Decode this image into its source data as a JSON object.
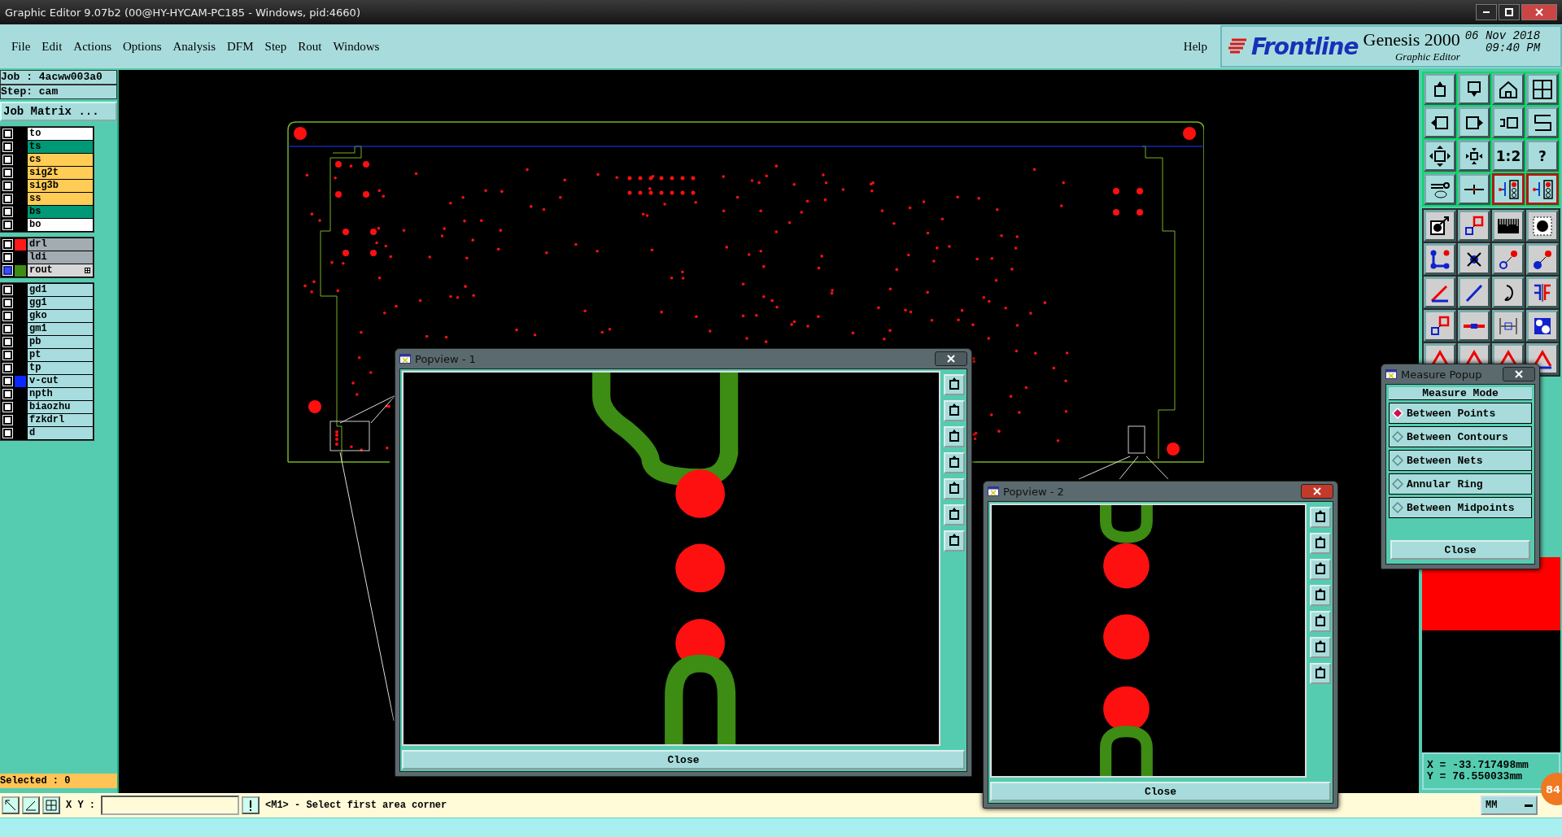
{
  "window": {
    "title": "Graphic Editor 9.07b2 (00@HY-HYCAM-PC185 - Windows, pid:4660)"
  },
  "menu": [
    "File",
    "Edit",
    "Actions",
    "Options",
    "Analysis",
    "DFM",
    "Step",
    "Rout",
    "Windows"
  ],
  "help": "Help",
  "brand": {
    "logo": "Frontline",
    "product": "Genesis 2000",
    "subtitle": "Graphic Editor",
    "date": "06 Nov 2018",
    "time": "09:40 PM"
  },
  "job": {
    "job": "Job : 4acww003a0",
    "step": "Step: cam",
    "matrix_button": "Job Matrix ..."
  },
  "layer_groups": [
    {
      "layers": [
        {
          "name": "to",
          "active": false,
          "kind": "silk"
        },
        {
          "name": "ts",
          "active": false,
          "kind": "mask"
        },
        {
          "name": "cs",
          "active": false,
          "kind": "signal"
        },
        {
          "name": "sig2t",
          "active": false,
          "kind": "signal"
        },
        {
          "name": "sig3b",
          "active": false,
          "kind": "signal"
        },
        {
          "name": "ss",
          "active": false,
          "kind": "signal"
        },
        {
          "name": "bs",
          "active": false,
          "kind": "mask"
        },
        {
          "name": "bo",
          "active": false,
          "kind": "silk"
        }
      ]
    },
    {
      "layers": [
        {
          "name": "drl",
          "active": false,
          "kind": "drill",
          "color": "#ff1a1a"
        },
        {
          "name": "ldi",
          "active": false,
          "kind": "drill"
        },
        {
          "name": "rout",
          "active": true,
          "kind": "rout",
          "color": "#3d8c14"
        }
      ]
    },
    {
      "layers": [
        {
          "name": "gd1",
          "active": false,
          "kind": "document"
        },
        {
          "name": "gg1",
          "active": false,
          "kind": "document"
        },
        {
          "name": "gko",
          "active": false,
          "kind": "document"
        },
        {
          "name": "gm1",
          "active": false,
          "kind": "document"
        },
        {
          "name": "pb",
          "active": false,
          "kind": "document"
        },
        {
          "name": "pt",
          "active": false,
          "kind": "document"
        },
        {
          "name": "tp",
          "active": false,
          "kind": "document"
        },
        {
          "name": "v-cut",
          "active": false,
          "kind": "document",
          "color": "#0a28ff"
        },
        {
          "name": "npth",
          "active": false,
          "kind": "document"
        },
        {
          "name": "biaozhu",
          "active": false,
          "kind": "document"
        },
        {
          "name": "fzkdrl",
          "active": false,
          "kind": "document"
        },
        {
          "name": "d",
          "active": false,
          "kind": "document"
        }
      ]
    }
  ],
  "selected_count": "Selected : 0",
  "toolbar": [
    {
      "kind": "icon",
      "selected": false
    },
    {
      "kind": "icon",
      "selected": false
    },
    {
      "kind": "icon",
      "selected": false
    },
    {
      "kind": "icon",
      "selected": false
    },
    {
      "kind": "icon",
      "selected": false
    },
    {
      "kind": "icon",
      "selected": false
    },
    {
      "kind": "icon",
      "selected": false
    },
    {
      "kind": "icon",
      "selected": false
    },
    {
      "kind": "icon",
      "selected": false
    },
    {
      "kind": "icon",
      "selected": false
    },
    {
      "kind": "text",
      "label": "1:2",
      "selected": false
    },
    {
      "kind": "text",
      "label": "?",
      "selected": false
    },
    {
      "kind": "icon",
      "selected": false
    },
    {
      "kind": "icon",
      "selected": false
    },
    {
      "kind": "icon",
      "selected": true
    },
    {
      "kind": "icon",
      "selected": true
    },
    {
      "kind": "icon",
      "selected": false
    },
    {
      "kind": "icon",
      "selected": false
    },
    {
      "kind": "icon",
      "selected": false
    },
    {
      "kind": "icon",
      "selected": false
    },
    {
      "kind": "icon",
      "selected": false
    },
    {
      "kind": "icon",
      "selected": false
    },
    {
      "kind": "icon",
      "selected": false
    },
    {
      "kind": "icon",
      "selected": false
    },
    {
      "kind": "icon",
      "selected": false
    },
    {
      "kind": "icon",
      "selected": false
    },
    {
      "kind": "icon",
      "selected": false
    },
    {
      "kind": "icon",
      "selected": false
    },
    {
      "kind": "icon",
      "selected": false
    },
    {
      "kind": "icon",
      "selected": false
    },
    {
      "kind": "icon",
      "selected": false
    },
    {
      "kind": "icon",
      "selected": false
    },
    {
      "kind": "icon",
      "selected": false
    },
    {
      "kind": "icon",
      "selected": false
    },
    {
      "kind": "icon",
      "selected": false
    },
    {
      "kind": "icon",
      "selected": false
    }
  ],
  "measure_popup": {
    "title": "Measure Popup",
    "heading": "Measure Mode",
    "options": [
      {
        "label": "Between Points",
        "selected": true
      },
      {
        "label": "Between Contours",
        "selected": false
      },
      {
        "label": "Between Nets",
        "selected": false
      },
      {
        "label": "Annular Ring",
        "selected": false
      },
      {
        "label": "Between Midpoints",
        "selected": false
      }
    ],
    "close": "Close"
  },
  "popviews": [
    {
      "title": "Popview - 1",
      "close": "Close"
    },
    {
      "title": "Popview - 2",
      "close": "Close"
    }
  ],
  "coordinates": {
    "x": "X = -33.717498mm",
    "y": "Y = 76.550033mm"
  },
  "bottom": {
    "xy_label": "X Y :",
    "message": "<M1> - Select first area corner",
    "units": "MM",
    "badge": "84"
  }
}
